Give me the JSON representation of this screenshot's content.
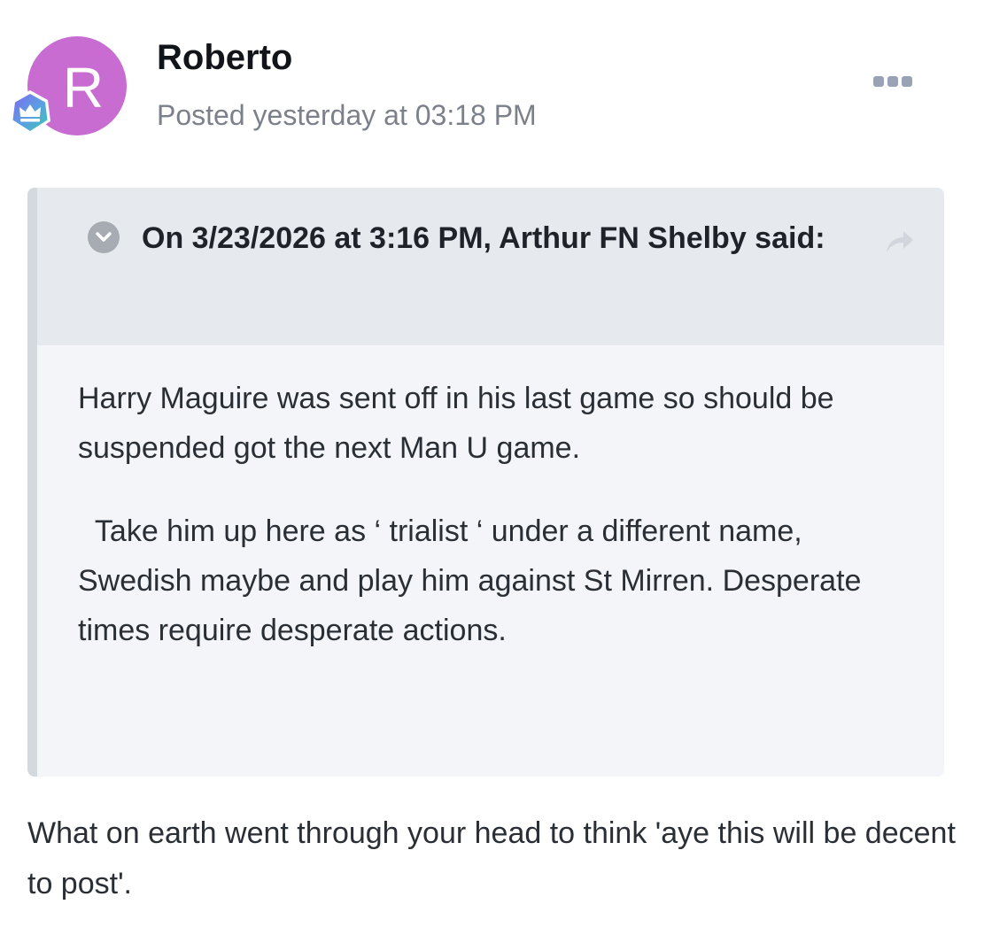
{
  "post": {
    "author": {
      "name": "Roberto",
      "avatar_letter": "R",
      "avatar_color": "#c86cd1",
      "rank_badge_icon": "crown-icon"
    },
    "timestamp": "Posted yesterday at 03:18 PM",
    "menu_icon": "ellipsis-icon",
    "quote": {
      "citation": "On 3/23/2026 at 3:16 PM, Arthur FN Shelby said:",
      "collapse_icon": "chevron-down-icon",
      "share_icon": "share-arrow-icon",
      "paragraphs": [
        "Harry Maguire was sent off in his last game so should be suspended got the next Man U game.",
        "  Take him up here as ‘ trialist ‘ under a different name, Swedish maybe and play him against St Mirren. Desperate times require desperate actions."
      ]
    },
    "reply": "What on earth went through your head to think 'aye this will be decent to post'."
  }
}
